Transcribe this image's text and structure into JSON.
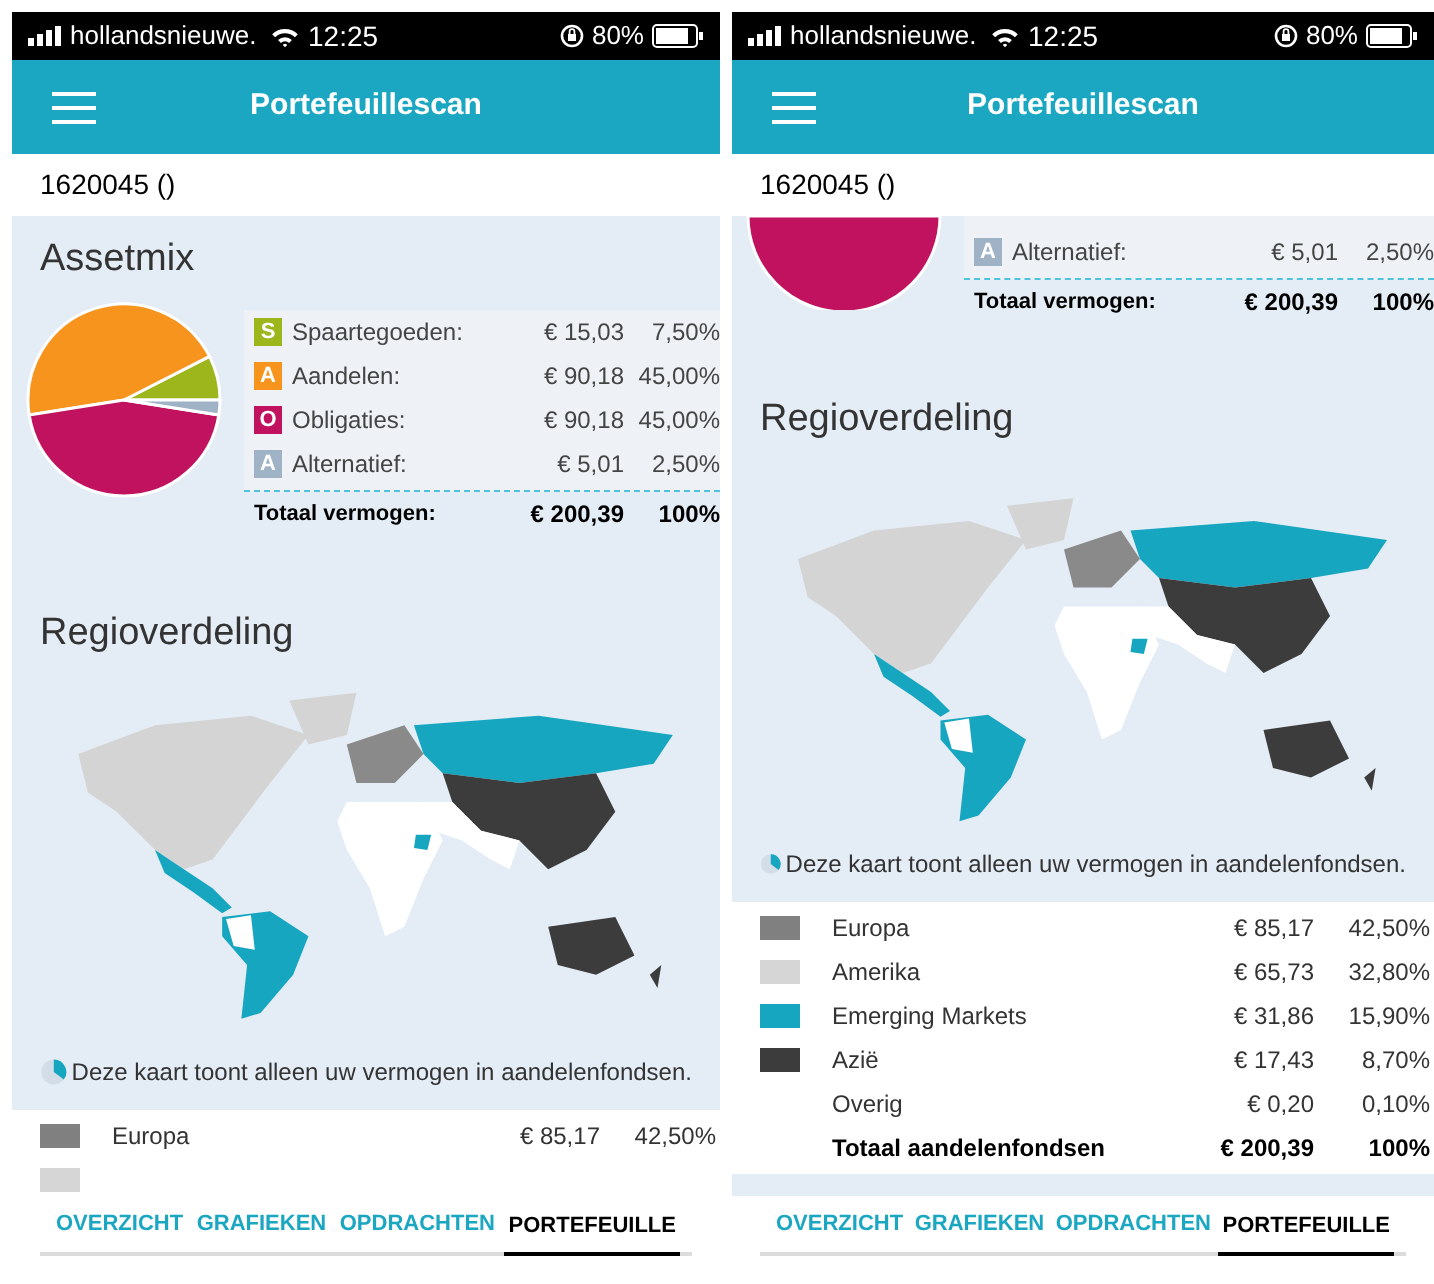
{
  "screens": [
    {
      "status_bar": {
        "carrier": "hollandsnieuwe.",
        "time": "12:25",
        "battery": "80%"
      },
      "header": {
        "title": "Portefeuillescan"
      },
      "account": "1620045 ()",
      "assetmix": {
        "title": "Assetmix",
        "chart_data": {
          "type": "pie",
          "values": [
            7.5,
            45,
            45,
            2.5
          ]
        },
        "items": [
          {
            "letter": "S",
            "label": "Spaartegoeden:",
            "amount": "€ 15,03",
            "percent": "7,50%",
            "color": "#9cb61c"
          },
          {
            "letter": "A",
            "label": "Aandelen:",
            "amount": "€ 90,18",
            "percent": "45,00%",
            "color": "#f7941d"
          },
          {
            "letter": "O",
            "label": "Obligaties:",
            "amount": "€ 90,18",
            "percent": "45,00%",
            "color": "#c0125f"
          },
          {
            "letter": "A",
            "label": "Alternatief:",
            "amount": "€ 5,01",
            "percent": "2,50%",
            "color": "#9fb2c6"
          }
        ],
        "total": {
          "label": "Totaal vermogen:",
          "amount": "€ 200,39",
          "percent": "100%"
        }
      },
      "regions": {
        "title": "Regioverdeling",
        "note": "Deze kaart toont alleen uw vermogen in aandelenfondsen.",
        "rows": [
          {
            "name": "Europa",
            "amount": "€ 85,17",
            "percent": "42,50%",
            "color": "#808080"
          },
          {
            "color": "#d6d6d6"
          }
        ]
      },
      "tabs": [
        {
          "label": "OVERZICHT",
          "selected": false
        },
        {
          "label": "GRAFIEKEN",
          "selected": false
        },
        {
          "label": "OPDRACHTEN",
          "selected": false
        },
        {
          "label": "PORTEFEUILLE",
          "selected": true
        }
      ]
    },
    {
      "status_bar": {
        "carrier": "hollandsnieuwe.",
        "time": "12:25",
        "battery": "80%"
      },
      "header": {
        "title": "Portefeuillescan"
      },
      "account": "1620045 ()",
      "assetmix": {
        "items": [
          {
            "letter": "A",
            "label": "Alternatief:",
            "amount": "€ 5,01",
            "percent": "2,50%",
            "color": "#9fb2c6"
          }
        ],
        "total": {
          "label": "Totaal vermogen:",
          "amount": "€ 200,39",
          "percent": "100%"
        }
      },
      "regions": {
        "title": "Regioverdeling",
        "note": "Deze kaart toont alleen uw vermogen in aandelenfondsen.",
        "rows": [
          {
            "name": "Europa",
            "amount": "€ 85,17",
            "percent": "42,50%",
            "color": "#808080"
          },
          {
            "name": "Amerika",
            "amount": "€ 65,73",
            "percent": "32,80%",
            "color": "#d6d6d6"
          },
          {
            "name": "Emerging Markets",
            "amount": "€ 31,86",
            "percent": "15,90%",
            "color": "#16a6c0"
          },
          {
            "name": "Azië",
            "amount": "€ 17,43",
            "percent": "8,70%",
            "color": "#3c3c3c"
          },
          {
            "name": "Overig",
            "amount": "€ 0,20",
            "percent": "0,10%"
          }
        ],
        "total": {
          "label": "Totaal aandelenfondsen",
          "amount": "€ 200,39",
          "percent": "100%"
        }
      },
      "tabs": [
        {
          "label": "OVERZICHT",
          "selected": false
        },
        {
          "label": "GRAFIEKEN",
          "selected": false
        },
        {
          "label": "OPDRACHTEN",
          "selected": false
        },
        {
          "label": "PORTEFEUILLE",
          "selected": true
        }
      ]
    }
  ]
}
